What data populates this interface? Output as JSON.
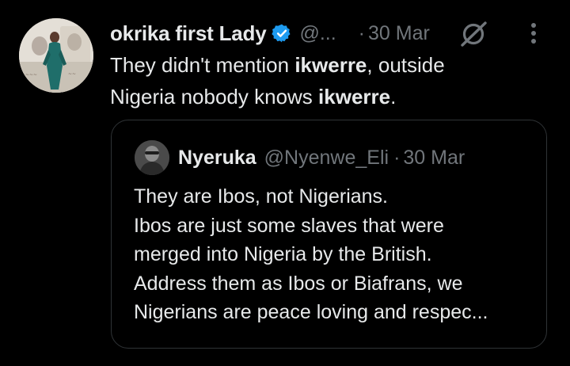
{
  "tweet": {
    "author": {
      "display_name": "okrika first Lady",
      "handle": "@...",
      "verified": true,
      "avatar_icon": "profile-photo"
    },
    "separator": "·",
    "date": "30 Mar",
    "text": {
      "line1_prefix": "They didn't mention ",
      "line1_bold": "ikwerre",
      "line1_suffix": ", outside",
      "line2_prefix": "Nigeria nobody knows ",
      "line2_bold": "ikwerre",
      "line2_suffix": "."
    },
    "actions": {
      "grok_icon": "grok-icon",
      "more_icon": "more-vertical-icon"
    }
  },
  "quoted_tweet": {
    "author": {
      "display_name": "Nyeruka",
      "handle": "@Nyenwe_Eli",
      "avatar_icon": "profile-photo"
    },
    "separator": "·",
    "date": "30 Mar",
    "lines": [
      "They are Ibos, not Nigerians.",
      "Ibos are just some slaves that were",
      "merged into Nigeria by the British.",
      "Address them as Ibos or Biafrans, we",
      "Nigerians are peace loving and respec..."
    ]
  },
  "colors": {
    "background": "#000000",
    "primary_text": "#e7e9ea",
    "secondary_text": "#71767b",
    "border": "#2f3336",
    "verified_badge": "#1d9bf0"
  }
}
